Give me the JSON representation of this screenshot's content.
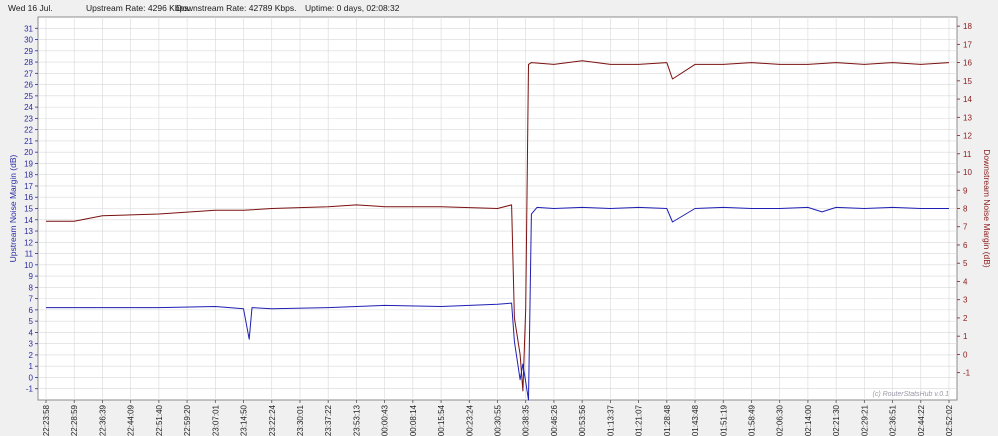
{
  "header": {
    "date": "Wed 16 Jul.",
    "upstream_rate": "Upstream Rate: 4296 Kbps.",
    "downstream_rate": "Downstream Rate: 42789 Kbps.",
    "uptime": "Uptime: 0 days, 02:08:32"
  },
  "colors": {
    "upstream": "#1f1fb4",
    "downstream": "#7a1010",
    "grid": "#d8d8d8",
    "plot_bg": "#ffffff"
  },
  "watermark": "(c) RouterStatsHub v.0.1",
  "chart_data": {
    "type": "line",
    "y_left": {
      "label": "Upstream Noise Margin (dB)",
      "range": [
        -2,
        32
      ],
      "ticks": [
        -1,
        0,
        1,
        2,
        3,
        4,
        5,
        6,
        7,
        8,
        9,
        10,
        11,
        12,
        13,
        14,
        15,
        16,
        17,
        18,
        19,
        20,
        21,
        22,
        23,
        24,
        25,
        26,
        27,
        28,
        29,
        30,
        31
      ]
    },
    "y_right": {
      "label": "Downstream Noise Margin (dB)",
      "range": [
        -2.5,
        18.5
      ],
      "ticks": [
        -1,
        0,
        1,
        2,
        3,
        4,
        5,
        6,
        7,
        8,
        9,
        10,
        11,
        12,
        13,
        14,
        15,
        16,
        17,
        18
      ]
    },
    "x_ticks": [
      "22:23:58",
      "22:28:59",
      "22:36:39",
      "22:44:09",
      "22:51:40",
      "22:59:20",
      "23:07:01",
      "23:14:50",
      "23:22:24",
      "23:30:01",
      "23:37:22",
      "23:53:13",
      "00:00:43",
      "00:08:14",
      "00:15:54",
      "00:23:24",
      "00:30:55",
      "00:38:35",
      "00:46:26",
      "00:53:56",
      "01:13:37",
      "01:21:07",
      "01:28:48",
      "01:43:48",
      "01:51:19",
      "01:58:49",
      "02:06:30",
      "02:14:00",
      "02:21:30",
      "02:29:21",
      "02:36:51",
      "02:44:22",
      "02:52:02"
    ],
    "grid": true,
    "series": [
      {
        "name": "Upstream Noise Margin (dB)",
        "axis": "left",
        "x": [
          0,
          2,
          4,
          6,
          7,
          7.2,
          7.3,
          8,
          10,
          12,
          14,
          15,
          16,
          16.5,
          16.6,
          16.8,
          16.9,
          17.1,
          17.2,
          17.4,
          18,
          19,
          20,
          21,
          22,
          22.2,
          23,
          24,
          25,
          26,
          27,
          27.5,
          28,
          29,
          30,
          31,
          32
        ],
        "y": [
          6.2,
          6.2,
          6.2,
          6.3,
          6.1,
          3.4,
          6.2,
          6.1,
          6.2,
          6.4,
          6.3,
          6.4,
          6.5,
          6.6,
          3.2,
          -0.2,
          1.2,
          -2.0,
          14.5,
          15.1,
          15.0,
          15.1,
          15.0,
          15.1,
          15.0,
          13.8,
          15.0,
          15.1,
          15.0,
          15.0,
          15.1,
          14.7,
          15.1,
          15.0,
          15.1,
          15.0,
          15.0
        ]
      },
      {
        "name": "Downstream Noise Margin (dB)",
        "axis": "right",
        "x": [
          0,
          1,
          2,
          4,
          6,
          7,
          8,
          10,
          11,
          12,
          14,
          16,
          16.5,
          16.6,
          16.8,
          16.9,
          17.0,
          17.1,
          17.2,
          18,
          19,
          20,
          21,
          22,
          22.2,
          23,
          24,
          25,
          26,
          27,
          28,
          29,
          30,
          31,
          32
        ],
        "y": [
          7.3,
          7.3,
          7.6,
          7.7,
          7.9,
          7.9,
          8.0,
          8.1,
          8.2,
          8.1,
          8.1,
          8.0,
          8.2,
          2.0,
          0.0,
          -2.0,
          2.5,
          15.9,
          16.0,
          15.9,
          16.1,
          15.9,
          15.9,
          16.0,
          15.1,
          15.9,
          15.9,
          16.0,
          15.9,
          15.9,
          16.0,
          15.9,
          16.0,
          15.9,
          16.0
        ]
      }
    ]
  }
}
